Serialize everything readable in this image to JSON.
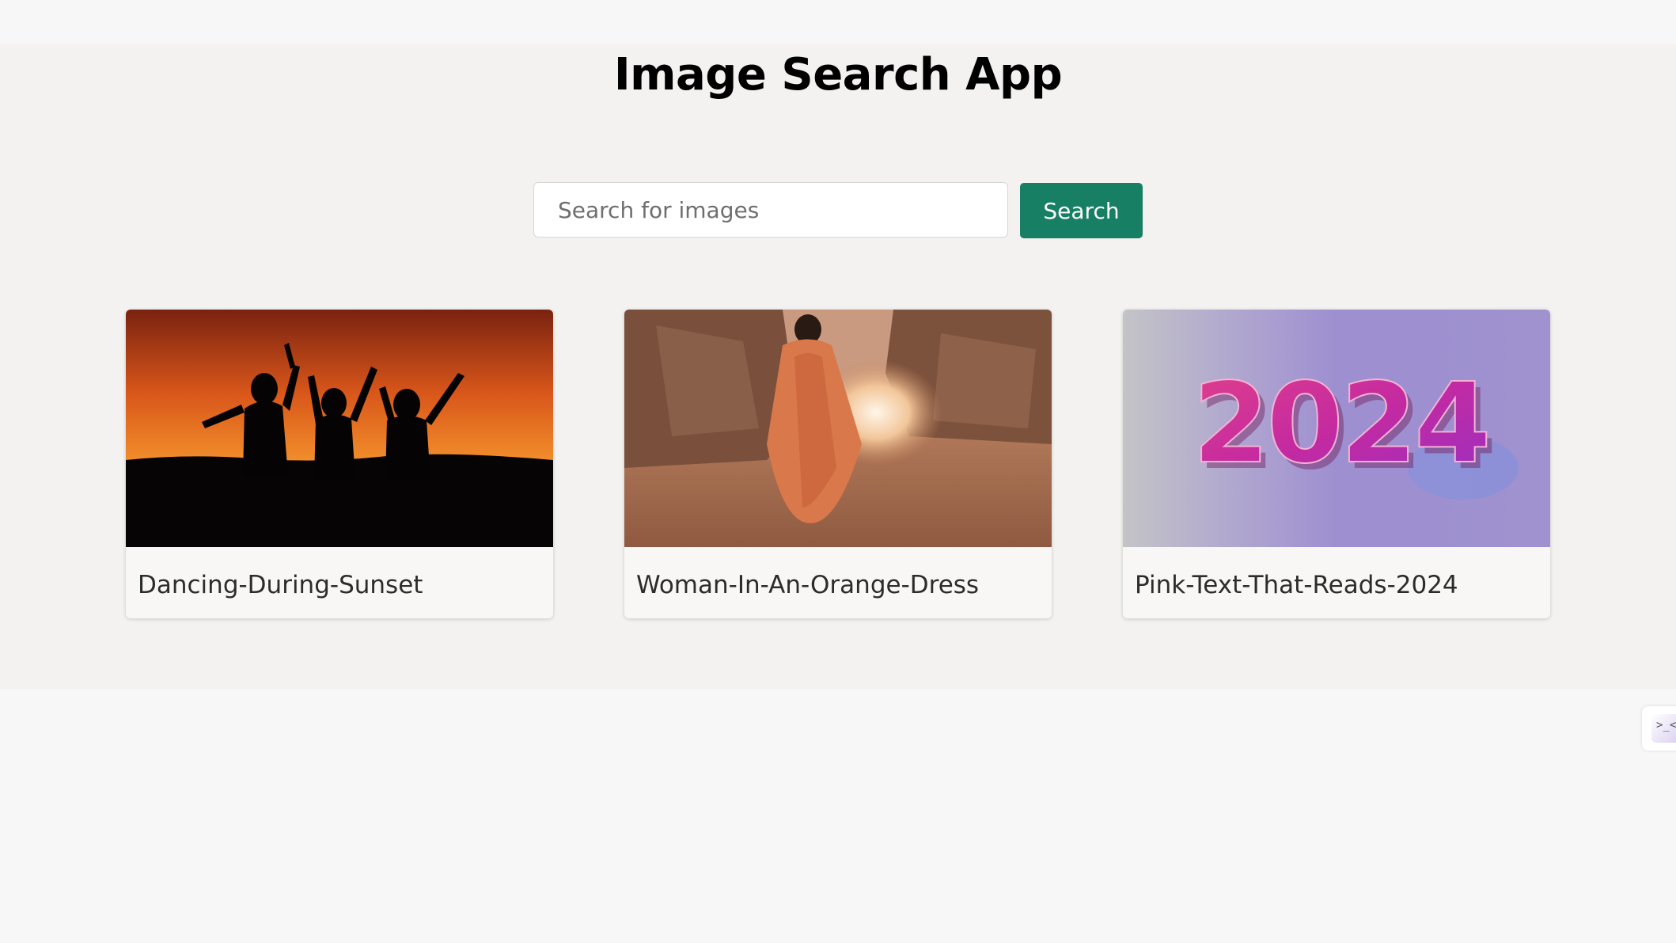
{
  "app": {
    "title": "Image Search App"
  },
  "search": {
    "placeholder": "Search for images",
    "value": "",
    "button_label": "Search"
  },
  "results": [
    {
      "caption": "Dancing-During-Sunset"
    },
    {
      "caption": "Woman-In-An-Orange-Dress"
    },
    {
      "caption": "Pink-Text-That-Reads-2024"
    }
  ],
  "colors": {
    "accent": "#177f63",
    "section_bg": "#f3f2f0",
    "page_bg": "#f8f7f7"
  },
  "side_widget": {
    "icon": "face-icon",
    "glyph": ">_<"
  }
}
